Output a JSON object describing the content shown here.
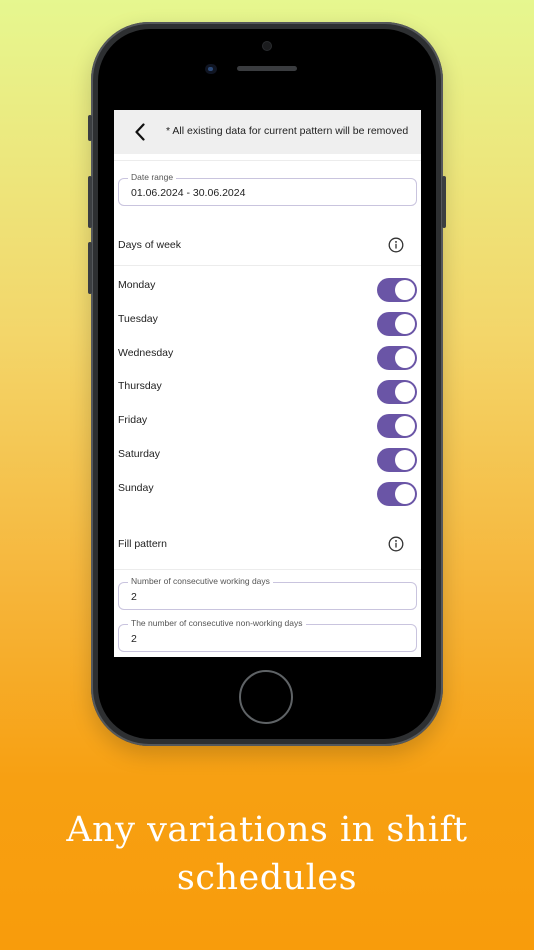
{
  "screen": {
    "topbar": {
      "note": "* All existing data for current pattern will be removed"
    },
    "date_range": {
      "label": "Date range",
      "value": "01.06.2024 - 30.06.2024"
    },
    "days_of_week": {
      "title": "Days of week",
      "days": [
        {
          "label": "Monday",
          "enabled": true
        },
        {
          "label": "Tuesday",
          "enabled": true
        },
        {
          "label": "Wednesday",
          "enabled": true
        },
        {
          "label": "Thursday",
          "enabled": true
        },
        {
          "label": "Friday",
          "enabled": true
        },
        {
          "label": "Saturday",
          "enabled": true
        },
        {
          "label": "Sunday",
          "enabled": true
        }
      ]
    },
    "fill_pattern": {
      "title": "Fill pattern",
      "working_days": {
        "label": "Number of consecutive working days",
        "value": "2"
      },
      "non_working_days": {
        "label": "The number of consecutive non-working days",
        "value": "2"
      }
    }
  },
  "caption": {
    "line1": "Any variations in shift",
    "line2": "schedules"
  },
  "colors": {
    "toggle_on": "#6a55a6",
    "background_top": "#e6f78f",
    "background_bottom": "#f89c0b"
  },
  "icons": {
    "back": "chevron-left-icon",
    "info": "info-circle-icon"
  }
}
